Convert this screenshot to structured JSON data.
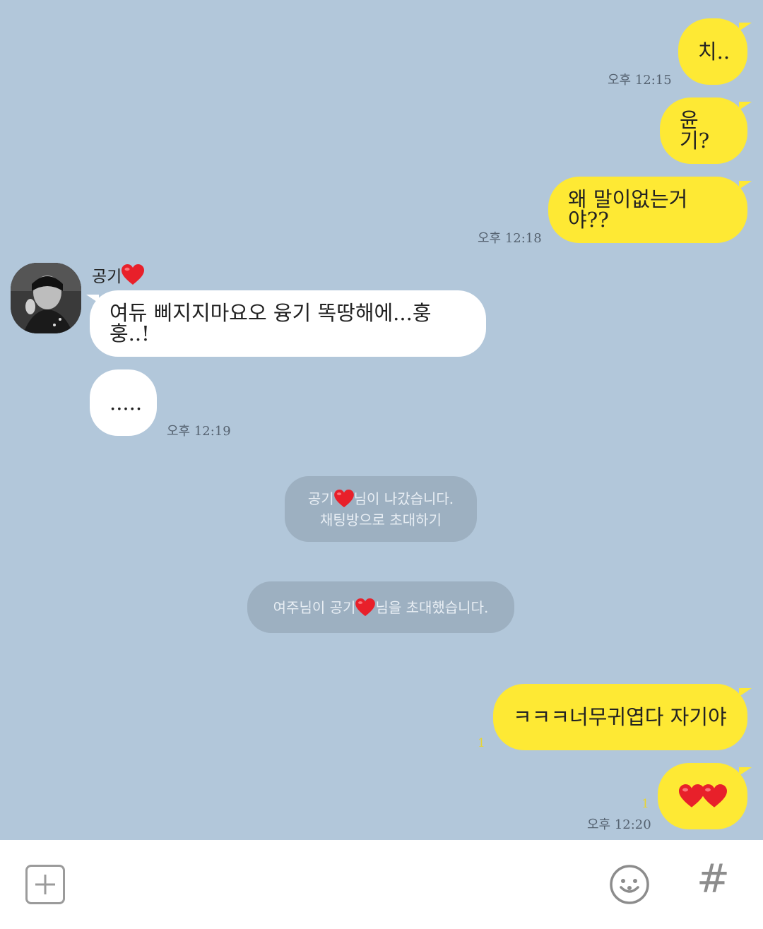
{
  "messages": {
    "m1": {
      "text": "치..",
      "time": "오후 12:15"
    },
    "m2": {
      "text": "윤기?"
    },
    "m3": {
      "text": "왜 말이없는거야??",
      "time": "오후 12:18"
    },
    "sender": {
      "name": "공기",
      "avatar_icon": "profile-photo"
    },
    "m4": {
      "text": "여듀 삐지지마요오 융기 똑땅해에...훙훙..!"
    },
    "m5": {
      "text": ".....",
      "time": "오후 12:19"
    },
    "sys1": {
      "line1_a": "공기",
      "line1_b": "님이 나갔습니다.",
      "line2": "채팅방으로 초대하기"
    },
    "sys2": {
      "part_a": "여주님이 공기",
      "part_b": "님을 초대했습니다."
    },
    "m6": {
      "text": "ㅋㅋㅋ너무귀엽다 자기야",
      "unread": "1"
    },
    "m7": {
      "unread": "1",
      "time": "오후 12:20"
    }
  },
  "input_bar": {
    "plus_icon": "plus-icon",
    "emoji_icon": "emoji-icon",
    "hash_icon": "hash-icon",
    "hash_glyph": "#"
  },
  "colors": {
    "background": "#b2c7da",
    "my_bubble": "#fee934",
    "other_bubble": "#ffffff",
    "system": "#9db0c1",
    "heart": "#e8202a"
  }
}
